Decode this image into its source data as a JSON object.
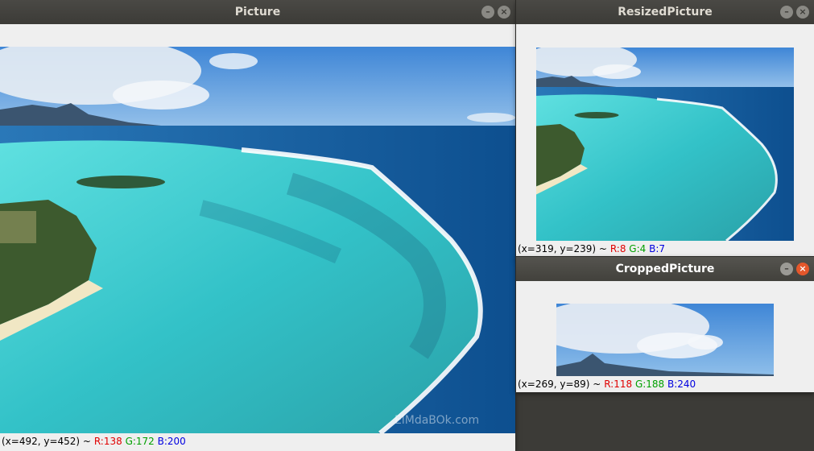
{
  "windows": {
    "picture": {
      "title": "Picture",
      "status": {
        "coords": "(x=492, y=452) ~",
        "r": "R:138",
        "g": "G:172",
        "b": "B:200"
      },
      "watermark": "ElMdaBOk.com"
    },
    "resized": {
      "title": "ResizedPicture",
      "status": {
        "coords": "(x=319, y=239) ~",
        "r": "R:8",
        "g": "G:4",
        "b": "B:7"
      }
    },
    "cropped": {
      "title": "CroppedPicture",
      "status": {
        "coords": "(x=269, y=89) ~",
        "r": "R:118",
        "g": "G:188",
        "b": "B:240"
      }
    }
  },
  "buttons": {
    "minimize": "–",
    "close": "×"
  },
  "colors": {
    "titlebar": "#3c3b37",
    "close_active": "#e5572b",
    "window_bg": "#efefef"
  }
}
